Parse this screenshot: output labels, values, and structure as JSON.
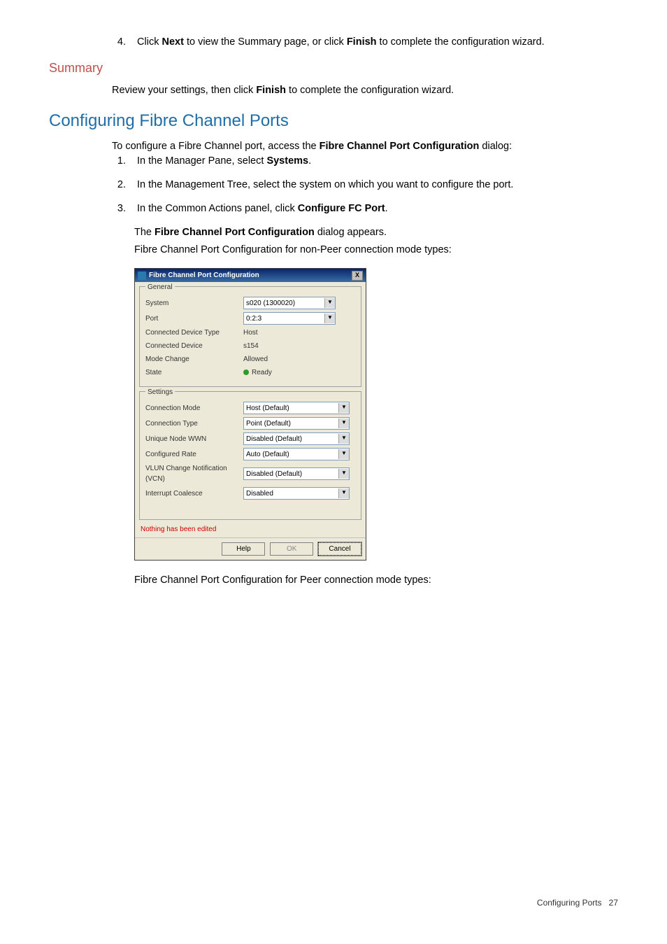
{
  "step4": {
    "num": "4.",
    "pre": "Click ",
    "b1": "Next",
    "mid": " to view the Summary page, or click ",
    "b2": "Finish",
    "post": " to complete the configuration wizard."
  },
  "summary_heading": "Summary",
  "summary_text_pre": "Review your settings, then click ",
  "summary_text_bold": "Finish",
  "summary_text_post": " to complete the configuration wizard.",
  "config_heading": "Configuring Fibre Channel Ports",
  "intro_pre": "To configure a Fibre Channel port, access the ",
  "intro_bold": "Fibre Channel Port Configuration",
  "intro_post": " dialog:",
  "steps": {
    "s1": {
      "n": "1.",
      "pre": "In the Manager Pane, select ",
      "b": "Systems",
      "post": "."
    },
    "s2": {
      "n": "2.",
      "t": "In the Management Tree, select the system on which you want to configure the port."
    },
    "s3": {
      "n": "3.",
      "pre": "In the Common Actions panel, click ",
      "b": "Configure FC Port",
      "post": "."
    }
  },
  "after3a_pre": "The ",
  "after3a_bold": "Fibre Channel Port Configuration",
  "after3a_post": " dialog appears.",
  "after3b": "Fibre Channel Port Configuration for non-Peer connection mode types:",
  "dialog": {
    "title": "Fibre Channel Port Configuration",
    "close": "X",
    "general_legend": "General",
    "system_label": "System",
    "system_value": "s020 (1300020)",
    "port_label": "Port",
    "port_value": "0:2:3",
    "cdt_label": "Connected Device Type",
    "cdt_value": "Host",
    "cd_label": "Connected Device",
    "cd_value": "s154",
    "mc_label": "Mode Change",
    "mc_value": "Allowed",
    "state_label": "State",
    "state_value": "Ready",
    "settings_legend": "Settings",
    "cm_label": "Connection Mode",
    "cm_value": "Host (Default)",
    "ct_label": "Connection Type",
    "ct_value": "Point (Default)",
    "un_label": "Unique Node WWN",
    "un_value": "Disabled (Default)",
    "cr_label": "Configured Rate",
    "cr_value": "Auto (Default)",
    "vcn_label": "VLUN Change Notification (VCN)",
    "vcn_value": "Disabled (Default)",
    "ic_label": "Interrupt Coalesce",
    "ic_value": "Disabled",
    "status": "Nothing has been edited",
    "btn_help": "Help",
    "btn_ok": "OK",
    "btn_cancel": "Cancel"
  },
  "peer_caption": "Fibre Channel Port Configuration for Peer connection mode types:",
  "footer_label": "Configuring Ports",
  "footer_page": "27"
}
